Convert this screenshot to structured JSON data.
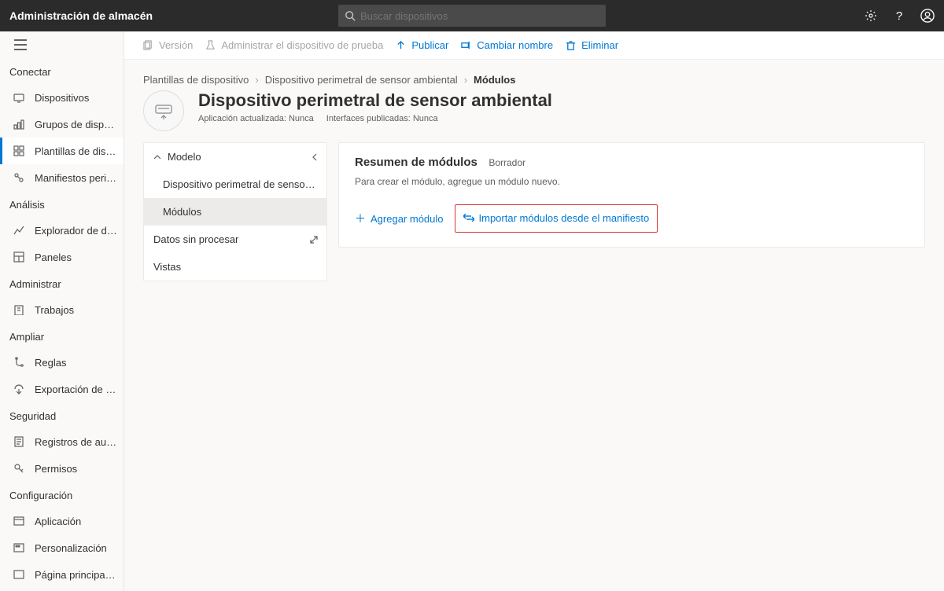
{
  "header": {
    "title": "Administración de almacén",
    "search_placeholder": "Buscar dispositivos"
  },
  "sidebar": {
    "sections": [
      {
        "label": "Conectar",
        "items": [
          {
            "label": "Dispositivos"
          },
          {
            "label": "Grupos de disposit..."
          },
          {
            "label": "Plantillas de dispo...",
            "active": true
          },
          {
            "label": "Manifiestos perimet..."
          }
        ]
      },
      {
        "label": "Análisis",
        "items": [
          {
            "label": "Explorador de datos"
          },
          {
            "label": "Paneles"
          }
        ]
      },
      {
        "label": "Administrar",
        "items": [
          {
            "label": "Trabajos"
          }
        ]
      },
      {
        "label": "Ampliar",
        "items": [
          {
            "label": "Reglas"
          },
          {
            "label": "Exportación de datos"
          }
        ]
      },
      {
        "label": "Seguridad",
        "items": [
          {
            "label": "Registros de auditoría"
          },
          {
            "label": "Permisos"
          }
        ]
      },
      {
        "label": "Configuración",
        "items": [
          {
            "label": "Aplicación"
          },
          {
            "label": "Personalización"
          },
          {
            "label": "Página principal de lo"
          }
        ]
      }
    ]
  },
  "toolbar": {
    "version": "Versión",
    "manage_test": "Administrar el dispositivo de prueba",
    "publish": "Publicar",
    "rename": "Cambiar nombre",
    "delete": "Eliminar"
  },
  "breadcrumbs": {
    "a": "Plantillas de dispositivo",
    "b": "Dispositivo perimetral de sensor ambiental",
    "c": "Módulos"
  },
  "page": {
    "title": "Dispositivo perimetral de sensor ambiental",
    "sub_app": "Aplicación actualizada: Nunca",
    "sub_if": "Interfaces publicadas: Nunca"
  },
  "model_panel": {
    "header": "Modelo",
    "items": [
      {
        "label": "Dispositivo perimetral de sensor am..."
      },
      {
        "label": "Módulos",
        "selected": true
      },
      {
        "label": "Datos sin procesar",
        "expand": true
      },
      {
        "label": "Vistas"
      }
    ]
  },
  "right_panel": {
    "title": "Resumen de módulos",
    "badge": "Borrador",
    "help": "Para crear el módulo, agregue un módulo nuevo.",
    "add": "Agregar módulo",
    "import": "Importar módulos desde el manifiesto"
  }
}
